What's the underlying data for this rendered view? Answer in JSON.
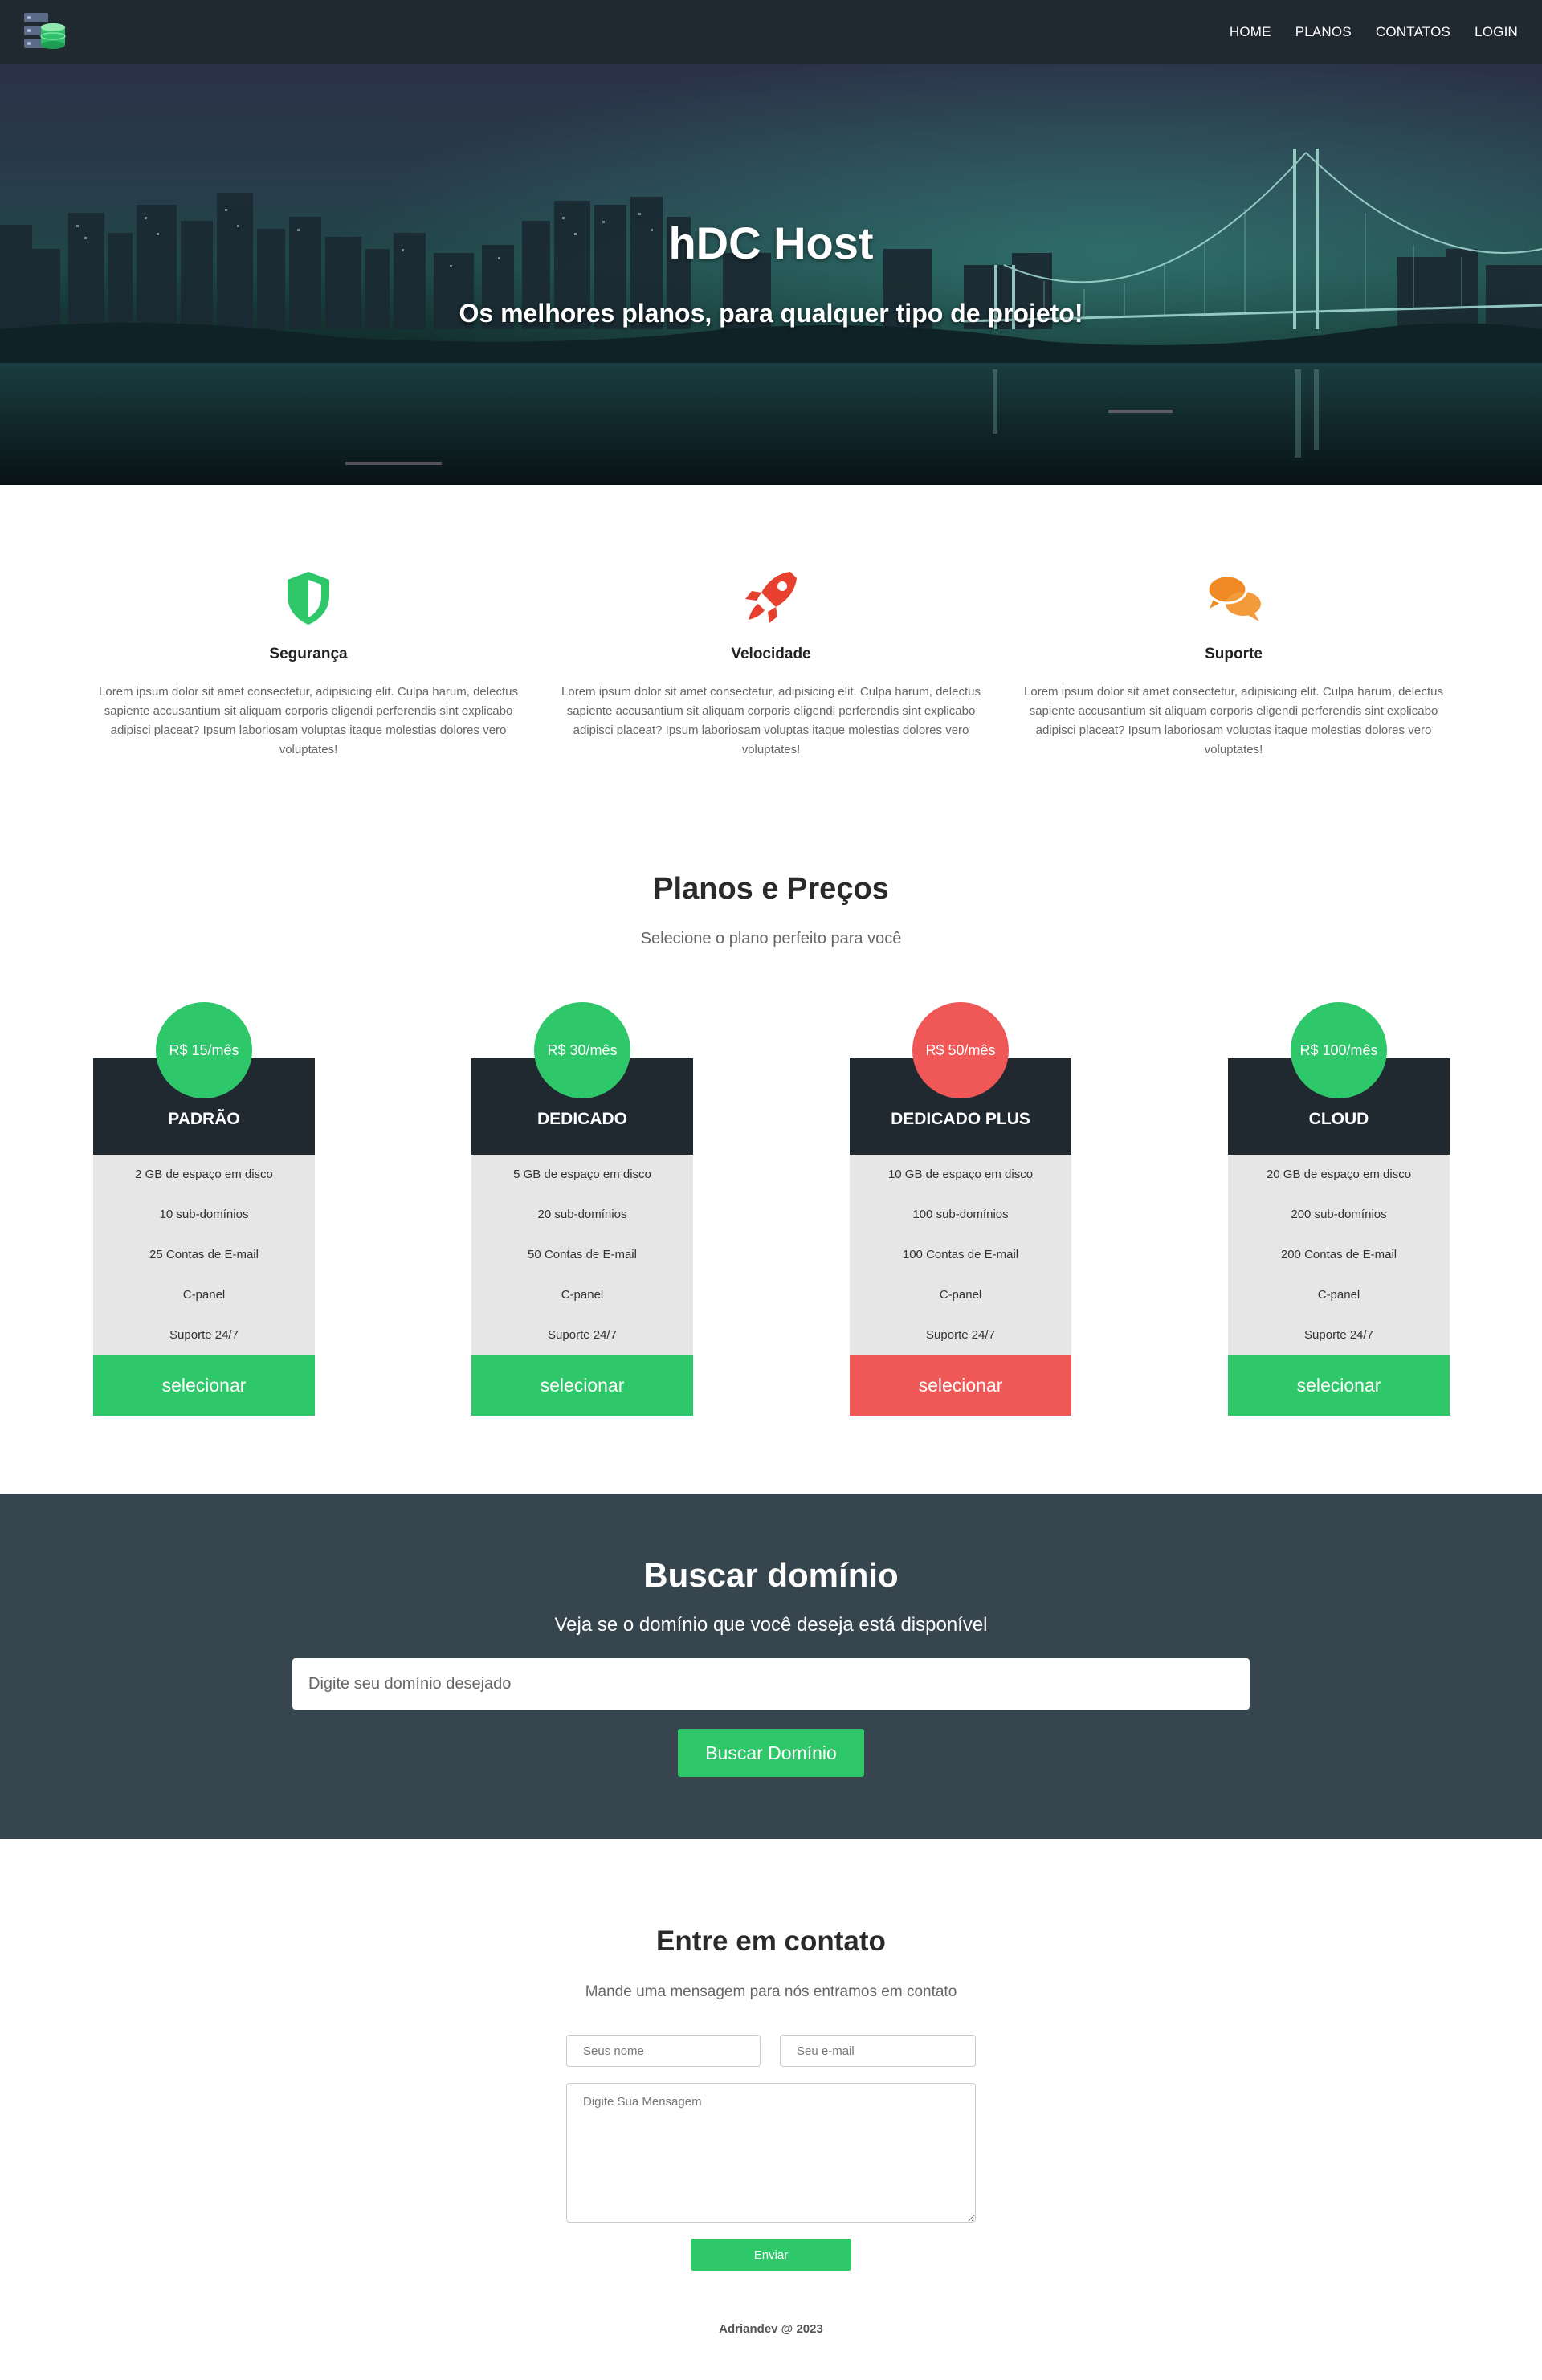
{
  "colors": {
    "nav_bg": "#202830",
    "accent_green": "#2ec76a",
    "accent_red": "#f05858",
    "accent_orange": "#ef8a24",
    "domain_bg": "#36454e",
    "plan_list_bg": "#e6e6e6"
  },
  "nav": {
    "logo_icon": "server-database-logo",
    "links": [
      "HOME",
      "PLANOS",
      "CONTATOS",
      "LOGIN"
    ]
  },
  "hero": {
    "title": "hDC Host",
    "subtitle": "Os melhores planos, para qualquer tipo de projeto!"
  },
  "features": [
    {
      "icon": "shield-icon",
      "title": "Segurança",
      "text": "Lorem ipsum dolor sit amet consectetur, adipisicing elit. Culpa harum, delectus sapiente accusantium sit aliquam corporis eligendi perferendis sint explicabo adipisci placeat? Ipsum laboriosam voluptas itaque molestias dolores vero voluptates!"
    },
    {
      "icon": "rocket-icon",
      "title": "Velocidade",
      "text": "Lorem ipsum dolor sit amet consectetur, adipisicing elit. Culpa harum, delectus sapiente accusantium sit aliquam corporis eligendi perferendis sint explicabo adipisci placeat? Ipsum laboriosam voluptas itaque molestias dolores vero voluptates!"
    },
    {
      "icon": "chat-bubbles-icon",
      "title": "Suporte",
      "text": "Lorem ipsum dolor sit amet consectetur, adipisicing elit. Culpa harum, delectus sapiente accusantium sit aliquam corporis eligendi perferendis sint explicabo adipisci placeat? Ipsum laboriosam voluptas itaque molestias dolores vero voluptates!"
    }
  ],
  "plans_section": {
    "title": "Planos e Preços",
    "subtitle": "Selecione o plano perfeito para você"
  },
  "plans": [
    {
      "price": "R$ 15/mês",
      "name": "PADRÃO",
      "color": "#2ec76a",
      "features": [
        "2 GB de espaço em disco",
        "10 sub-domínios",
        "25 Contas de E-mail",
        "C-panel",
        "Suporte 24/7"
      ],
      "button": "selecionar"
    },
    {
      "price": "R$ 30/mês",
      "name": "DEDICADO",
      "color": "#2ec76a",
      "features": [
        "5 GB de espaço em disco",
        "20 sub-domínios",
        "50 Contas de E-mail",
        "C-panel",
        "Suporte 24/7"
      ],
      "button": "selecionar"
    },
    {
      "price": "R$ 50/mês",
      "name": "DEDICADO PLUS",
      "color": "#f05858",
      "features": [
        "10 GB de espaço em disco",
        "100 sub-domínios",
        "100 Contas de E-mail",
        "C-panel",
        "Suporte 24/7"
      ],
      "button": "selecionar"
    },
    {
      "price": "R$ 100/mês",
      "name": "CLOUD",
      "color": "#2ec76a",
      "features": [
        "20 GB de espaço em disco",
        "200 sub-domínios",
        "200 Contas de E-mail",
        "C-panel",
        "Suporte 24/7"
      ],
      "button": "selecionar"
    }
  ],
  "domain": {
    "title": "Buscar domínio",
    "subtitle": "Veja se o domínio que você deseja está disponível",
    "placeholder": "Digite seu domínio desejado",
    "value": "",
    "button": "Buscar Domínio"
  },
  "contact": {
    "title": "Entre em contato",
    "subtitle": "Mande uma mensagem para nós entramos em contato",
    "name_placeholder": "Seus nome",
    "email_placeholder": "Seu e-mail",
    "message_placeholder": "Digite Sua Mensagem",
    "send": "Enviar"
  },
  "footer": {
    "text": "Adriandev @ 2023"
  }
}
